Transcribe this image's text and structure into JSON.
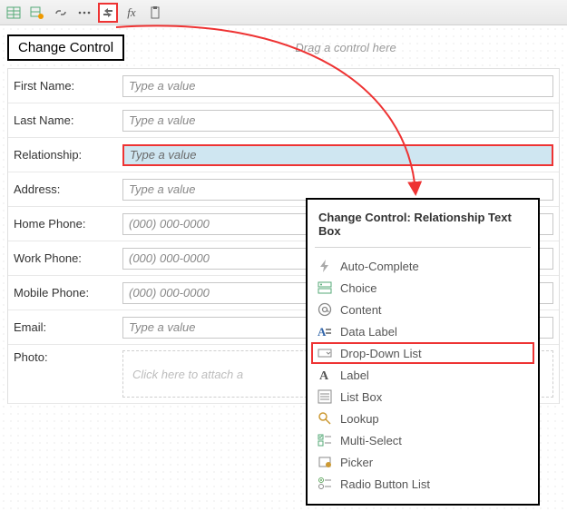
{
  "toolbar": {
    "buttons": [
      "grid-icon",
      "grid-plus-icon",
      "link-icon",
      "ellipsis-icon",
      "swap-icon",
      "fx-icon",
      "clipboard-icon"
    ]
  },
  "canvas": {
    "changeControlLabel": "Change Control",
    "dragHint": "Drag a control here"
  },
  "form": {
    "rows": [
      {
        "label": "First Name:",
        "placeholder": "Type a value",
        "sel": false
      },
      {
        "label": "Last Name:",
        "placeholder": "Type a value",
        "sel": false
      },
      {
        "label": "Relationship:",
        "placeholder": "Type a value",
        "sel": true
      },
      {
        "label": "Address:",
        "placeholder": "Type a value",
        "sel": false
      },
      {
        "label": "Home Phone:",
        "placeholder": "(000) 000-0000",
        "sel": false
      },
      {
        "label": "Work Phone:",
        "placeholder": "(000) 000-0000",
        "sel": false
      },
      {
        "label": "Mobile Phone:",
        "placeholder": "(000) 000-0000",
        "sel": false
      },
      {
        "label": "Email:",
        "placeholder": "Type a value",
        "sel": false
      }
    ],
    "photoLabel": "Photo:",
    "photoPlaceholder": "Click here to attach a"
  },
  "popup": {
    "title": "Change Control: Relationship Text Box",
    "items": [
      {
        "label": "Auto-Complete",
        "icon": "bolt-icon",
        "sel": false
      },
      {
        "label": "Choice",
        "icon": "choice-icon",
        "sel": false
      },
      {
        "label": "Content",
        "icon": "at-icon",
        "sel": false
      },
      {
        "label": "Data Label",
        "icon": "data-label-icon",
        "sel": false
      },
      {
        "label": "Drop-Down List",
        "icon": "dropdown-icon",
        "sel": true
      },
      {
        "label": "Label",
        "icon": "label-icon",
        "sel": false
      },
      {
        "label": "List Box",
        "icon": "list-icon",
        "sel": false
      },
      {
        "label": "Lookup",
        "icon": "lookup-icon",
        "sel": false
      },
      {
        "label": "Multi-Select",
        "icon": "multiselect-icon",
        "sel": false
      },
      {
        "label": "Picker",
        "icon": "picker-icon",
        "sel": false
      },
      {
        "label": "Radio Button List",
        "icon": "radio-icon",
        "sel": false
      }
    ]
  }
}
